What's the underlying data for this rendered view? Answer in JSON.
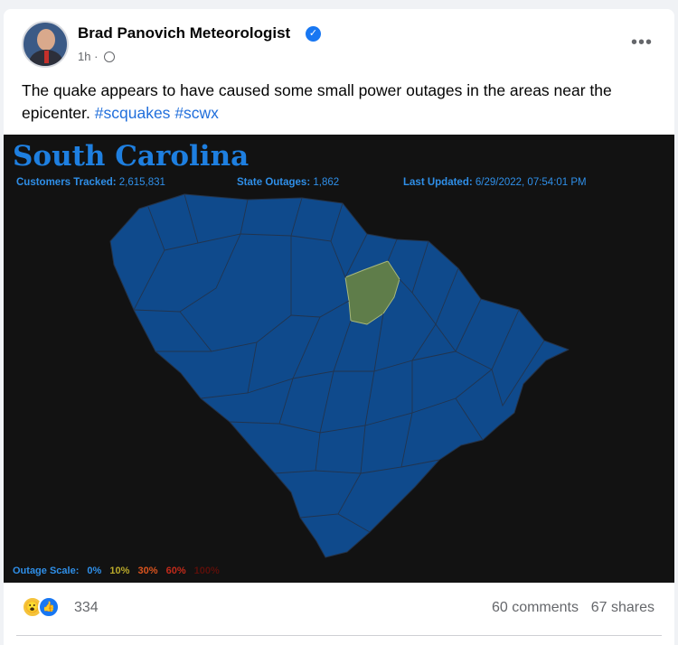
{
  "post": {
    "author": "Brad Panovich Meteorologist",
    "time": "1h",
    "time_separator": "·",
    "more_label": "•••",
    "verified_glyph": "✓",
    "text": "The quake appears to have caused some small power outages in the areas near the epicenter.",
    "hashtags": [
      "#scquakes",
      "#scwx"
    ]
  },
  "map": {
    "title": "South Carolina",
    "customers_label": "Customers Tracked:",
    "customers_value": "2,615,831",
    "outages_label": "State Outages:",
    "outages_value": "1,862",
    "updated_label": "Last Updated:",
    "updated_value": "6/29/2022, 07:54:01 PM",
    "scale_label": "Outage Scale:",
    "scale": [
      {
        "label": "0%",
        "color": "#2f8fe8"
      },
      {
        "label": "10%",
        "color": "#b9a92a"
      },
      {
        "label": "30%",
        "color": "#d9531e"
      },
      {
        "label": "60%",
        "color": "#c22a1a"
      },
      {
        "label": "100%",
        "color": "#5a0f0a"
      }
    ],
    "state_color": "#0f4a8c",
    "highlight_color": "#5f7d4a"
  },
  "footer": {
    "reaction_count": "334",
    "comments": "60 comments",
    "shares": "67 shares",
    "wow_icon": "😮",
    "like_icon": "👍"
  }
}
